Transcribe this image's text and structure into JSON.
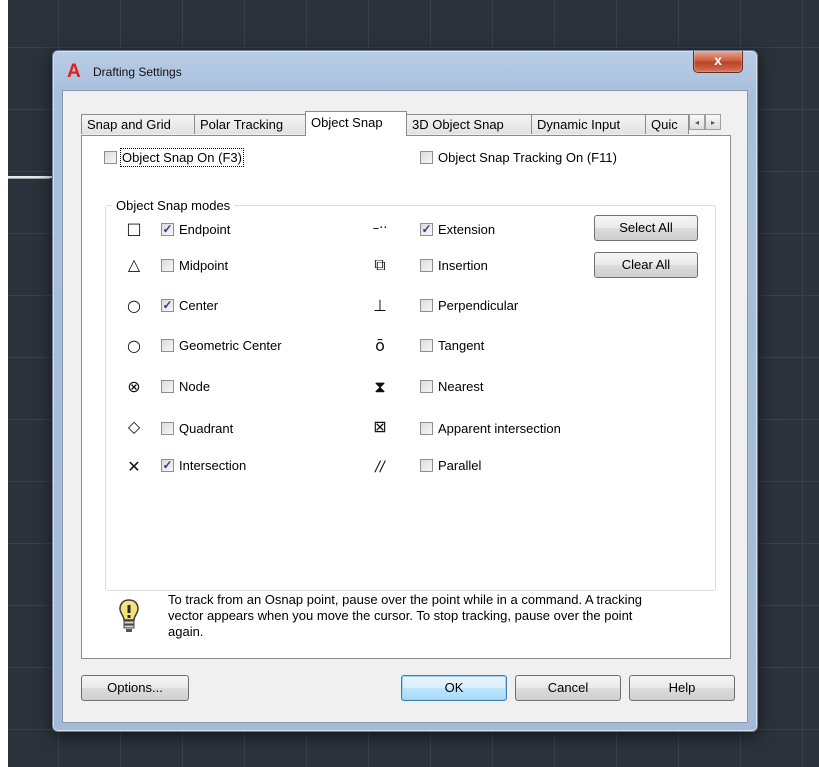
{
  "window": {
    "title": "Drafting Settings",
    "close_label": "x"
  },
  "tabs": [
    {
      "label": "Snap and Grid"
    },
    {
      "label": "Polar Tracking"
    },
    {
      "label": "Object Snap"
    },
    {
      "label": "3D Object Snap"
    },
    {
      "label": "Dynamic Input"
    },
    {
      "label": "Quic"
    }
  ],
  "tab_scroll": {
    "left": "◂",
    "right": "▸"
  },
  "object_snap_on": {
    "label": "Object Snap On (F3)",
    "checked": false
  },
  "tracking_on": {
    "label": "Object Snap Tracking On (F11)",
    "checked": false
  },
  "modes_group": {
    "label": "Object Snap modes"
  },
  "modes_left": [
    {
      "label": "Endpoint",
      "checked": true,
      "icon": "□"
    },
    {
      "label": "Midpoint",
      "checked": false,
      "icon": "△"
    },
    {
      "label": "Center",
      "checked": true,
      "icon": "○"
    },
    {
      "label": "Geometric Center",
      "checked": false,
      "icon": "○"
    },
    {
      "label": "Node",
      "checked": false,
      "icon": "⊗"
    },
    {
      "label": "Quadrant",
      "checked": false,
      "icon": "◇"
    },
    {
      "label": "Intersection",
      "checked": true,
      "icon": "✕"
    }
  ],
  "modes_right": [
    {
      "label": "Extension",
      "checked": true,
      "icon": "–··"
    },
    {
      "label": "Insertion",
      "checked": false,
      "icon": "⧉"
    },
    {
      "label": "Perpendicular",
      "checked": false,
      "icon": "⊥"
    },
    {
      "label": "Tangent",
      "checked": false,
      "icon": "ō"
    },
    {
      "label": "Nearest",
      "checked": false,
      "icon": "⧗"
    },
    {
      "label": "Apparent intersection",
      "checked": false,
      "icon": "⊠"
    },
    {
      "label": "Parallel",
      "checked": false,
      "icon": "//"
    }
  ],
  "buttons": {
    "select_all": "Select All",
    "clear_all": "Clear All",
    "options": "Options...",
    "ok": "OK",
    "cancel": "Cancel",
    "help": "Help"
  },
  "info_text": "To track from an Osnap point, pause over the point while in a command.  A tracking vector appears when you move the cursor.  To stop tracking, pause over the point again.",
  "colors": {
    "check_mark": "#2a3e8f",
    "logo_red": "#e0201a",
    "close_red": "#c75a3c"
  }
}
